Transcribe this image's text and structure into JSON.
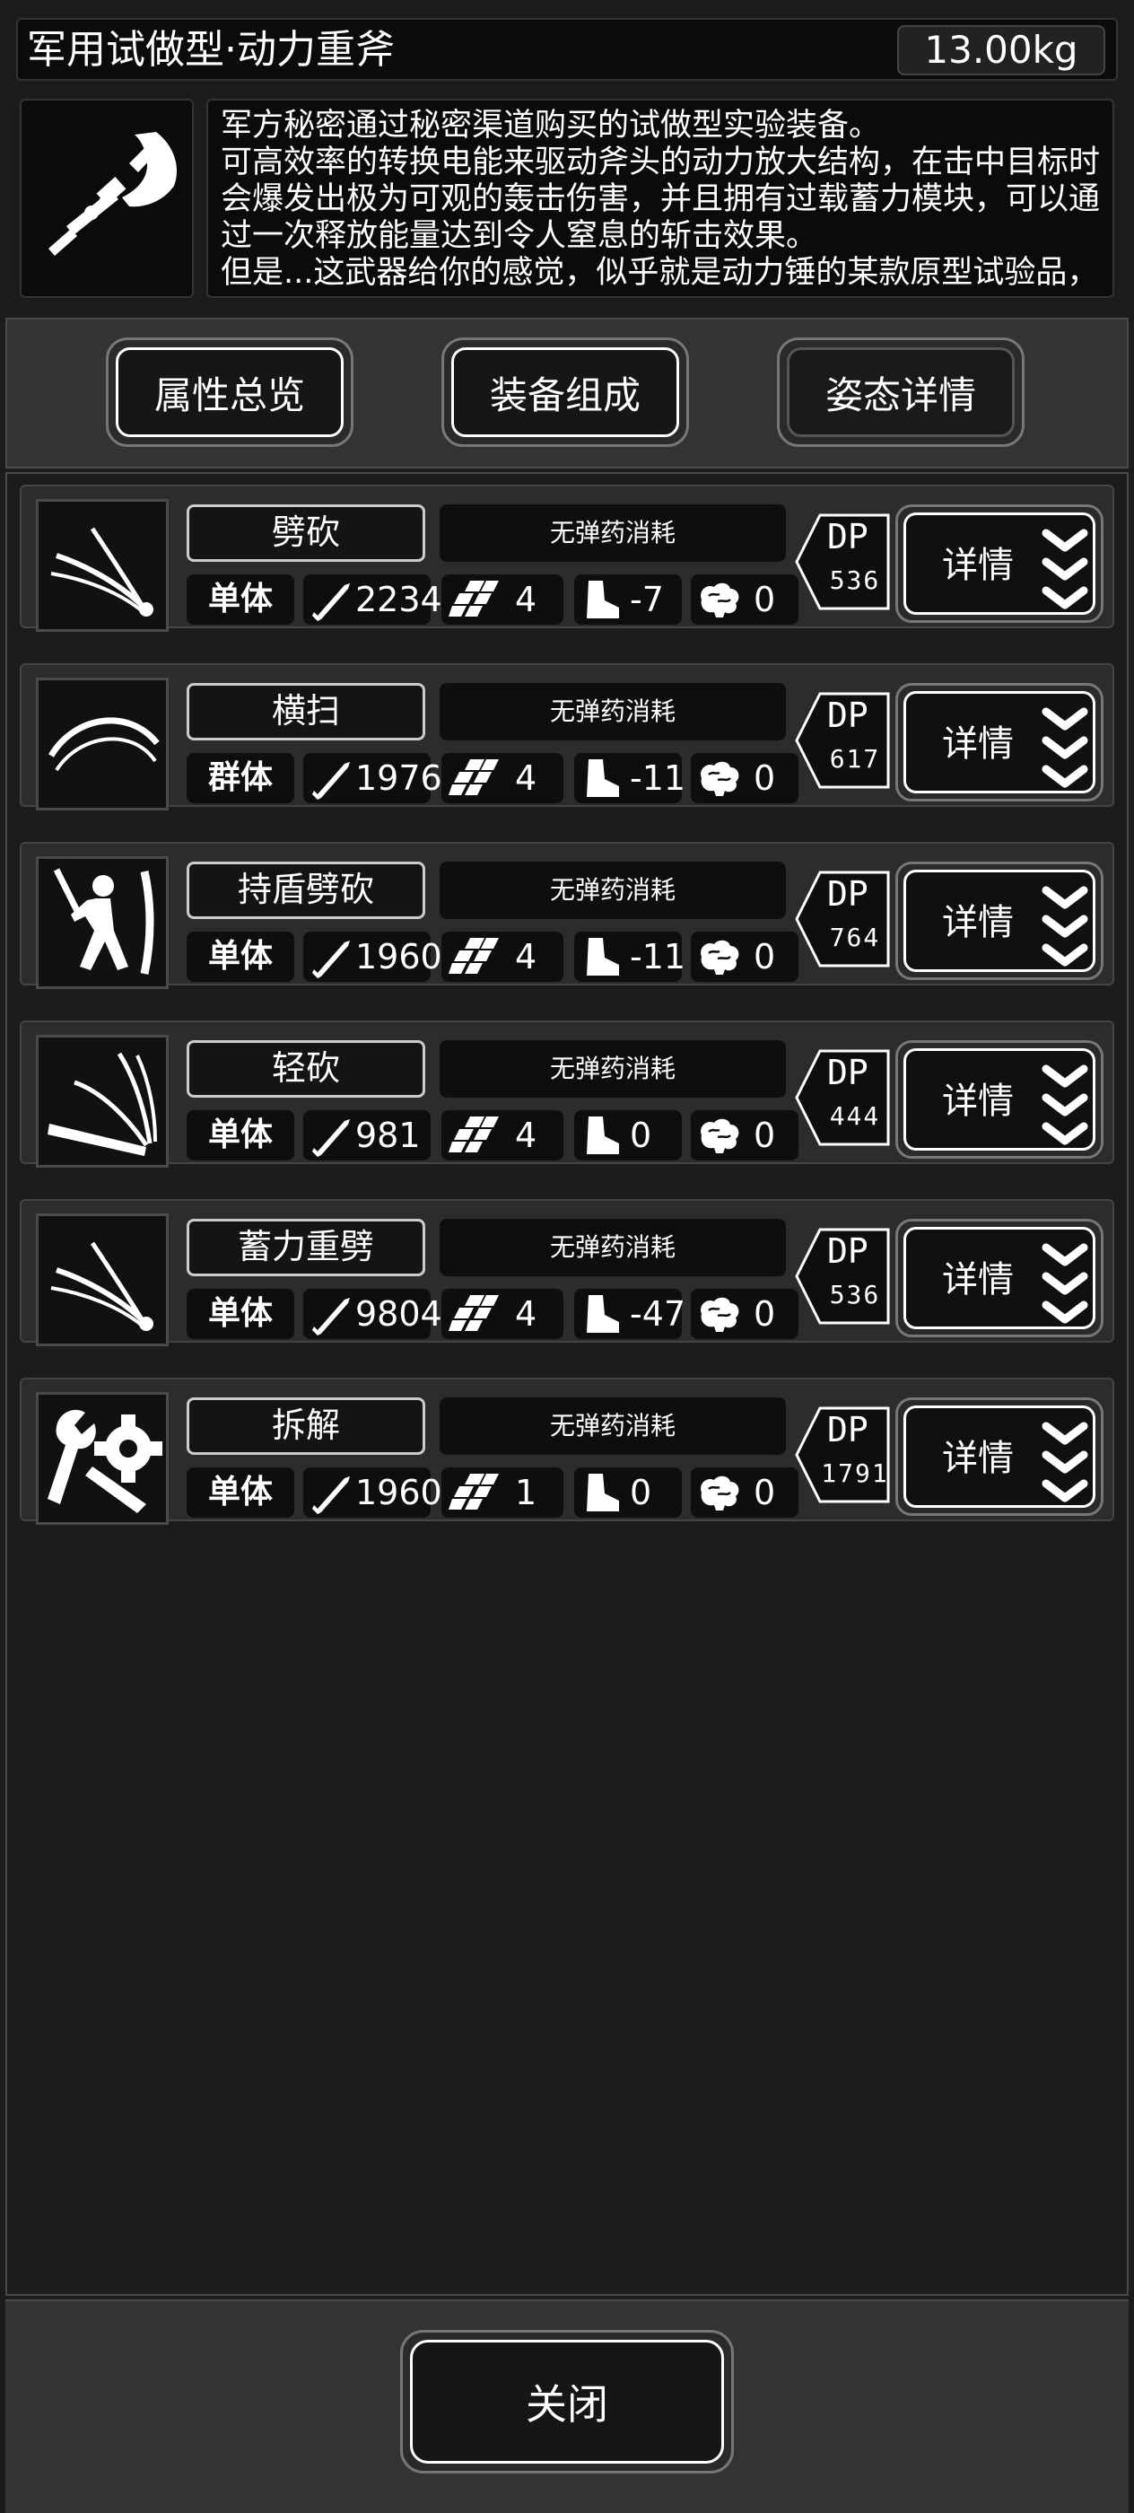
{
  "header": {
    "title": "军用试做型·动力重斧",
    "weight": "13.00kg",
    "item_icon": "power-axe-icon",
    "description": [
      "军方秘密通过秘密渠道购买的试做型实验装备。",
      "可高效率的转换电能来驱动斧头的动力放大结构，在击中目标时",
      "会爆发出极为可观的轰击伤害，并且拥有过载蓄力模块，可以通",
      "过一次释放能量达到令人窒息的斩击效果。",
      "但是...这武器给你的感觉，似乎就是动力锤的某款原型试验品，"
    ]
  },
  "tabs": [
    {
      "label": "属性总览",
      "selected": true
    },
    {
      "label": "装备组成",
      "selected": true
    },
    {
      "label": "姿态详情",
      "selected": false
    }
  ],
  "skills": [
    {
      "name": "劈砍",
      "ammo": "无弹药消耗",
      "target": "单体",
      "damage": "2234",
      "hits": "4",
      "move": "-7",
      "brain": "0",
      "dp_label": "DP",
      "dp": "536",
      "detail": "详情",
      "icon": "slash-icon"
    },
    {
      "name": "横扫",
      "ammo": "无弹药消耗",
      "target": "群体",
      "damage": "1976",
      "hits": "4",
      "move": "-11",
      "brain": "0",
      "dp_label": "DP",
      "dp": "617",
      "detail": "详情",
      "icon": "sweep-icon"
    },
    {
      "name": "持盾劈砍",
      "ammo": "无弹药消耗",
      "target": "单体",
      "damage": "1960",
      "hits": "4",
      "move": "-11",
      "brain": "0",
      "dp_label": "DP",
      "dp": "764",
      "detail": "详情",
      "icon": "shield-slash-icon"
    },
    {
      "name": "轻砍",
      "ammo": "无弹药消耗",
      "target": "单体",
      "damage": "981",
      "hits": "4",
      "move": "0",
      "brain": "0",
      "dp_label": "DP",
      "dp": "444",
      "detail": "详情",
      "icon": "light-slash-icon"
    },
    {
      "name": "蓄力重劈",
      "ammo": "无弹药消耗",
      "target": "单体",
      "damage": "9804",
      "hits": "4",
      "move": "-47",
      "brain": "0",
      "dp_label": "DP",
      "dp": "536",
      "detail": "详情",
      "icon": "charged-slash-icon"
    },
    {
      "name": "拆解",
      "ammo": "无弹药消耗",
      "target": "单体",
      "damage": "1960",
      "hits": "1",
      "move": "0",
      "brain": "0",
      "dp_label": "DP",
      "dp": "1791",
      "detail": "详情",
      "icon": "dismantle-icon"
    }
  ],
  "footer": {
    "close_label": "关闭"
  }
}
